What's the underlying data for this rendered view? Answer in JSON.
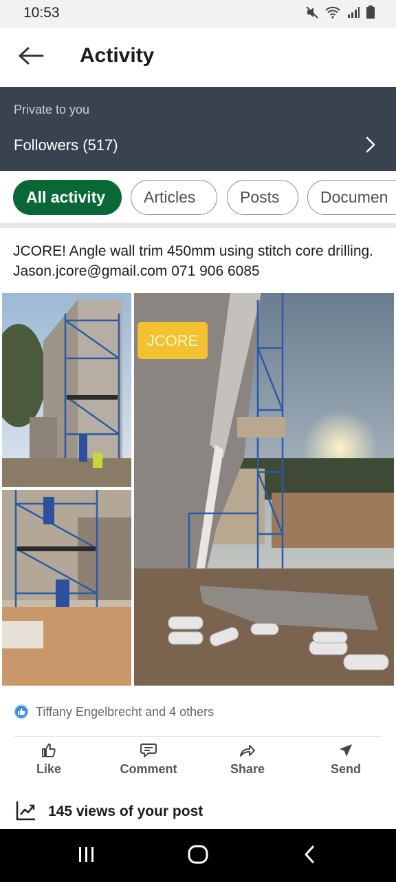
{
  "status_bar": {
    "time": "10:53",
    "icons": [
      "mute-icon",
      "wifi-icon",
      "signal-icon",
      "battery-icon"
    ]
  },
  "header": {
    "title": "Activity",
    "back_icon": "arrow-left-icon"
  },
  "followers_panel": {
    "private_label": "Private to you",
    "followers_label": "Followers (517)",
    "background": "#38434f"
  },
  "filters": {
    "tabs": [
      {
        "label": "All activity",
        "active": true
      },
      {
        "label": "Articles",
        "active": false
      },
      {
        "label": "Posts",
        "active": false
      },
      {
        "label": "Documen",
        "active": false
      }
    ],
    "active_color": "#0a6837"
  },
  "post": {
    "text": "JCORE! Angle wall trim 450mm using stitch core drilling. Jason.jcore@gmail.com 071 906 6085",
    "image_watermark": "JCORE",
    "reactions_text": "Tiffany Engelbrecht and 4 others",
    "actions": [
      {
        "label": "Like",
        "icon": "thumbs-up-icon"
      },
      {
        "label": "Comment",
        "icon": "comment-icon"
      },
      {
        "label": "Share",
        "icon": "share-arrow-icon"
      },
      {
        "label": "Send",
        "icon": "send-icon"
      }
    ],
    "views_text": "145 views of your post"
  },
  "nav_bar": {
    "buttons": [
      "recent-apps-icon",
      "home-icon",
      "back-icon"
    ]
  }
}
